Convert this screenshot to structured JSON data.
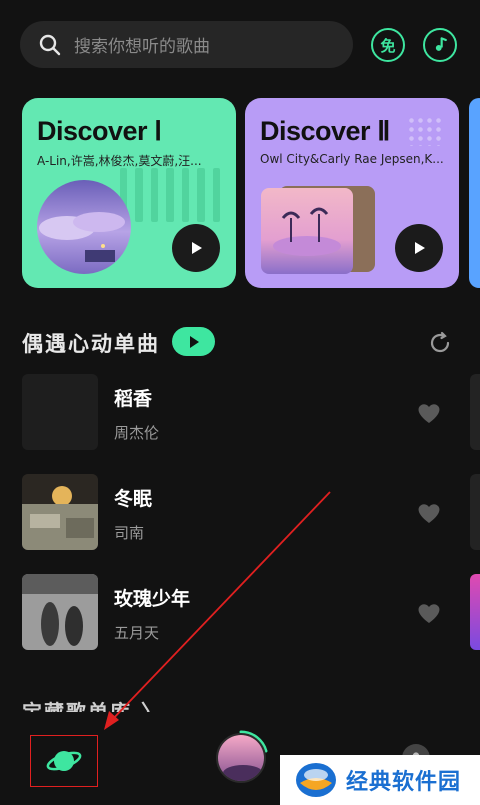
{
  "search": {
    "placeholder": "搜索你想听的歌曲"
  },
  "header_icons": {
    "free_label": "免"
  },
  "discover_cards": [
    {
      "title": "Discover Ⅰ",
      "subtitle": "A-Lin,许嵩,林俊杰,莫文蔚,汪..."
    },
    {
      "title": "Discover Ⅱ",
      "subtitle": "Owl City&Carly Rae Jepsen,K..."
    }
  ],
  "section": {
    "title": "偶遇心动单曲"
  },
  "songs": [
    {
      "title": "稻香",
      "artist": "周杰伦"
    },
    {
      "title": "冬眠",
      "artist": "司南"
    },
    {
      "title": "玫瑰少年",
      "artist": "五月天"
    }
  ],
  "section2": {
    "title": "宝藏歌单库 〉"
  },
  "watermark": {
    "text": "经典软件园"
  },
  "colors": {
    "accent": "#3ee6a0",
    "card1": "#63e8b2",
    "card2": "#b89cf6",
    "annotation": "#e02020"
  }
}
